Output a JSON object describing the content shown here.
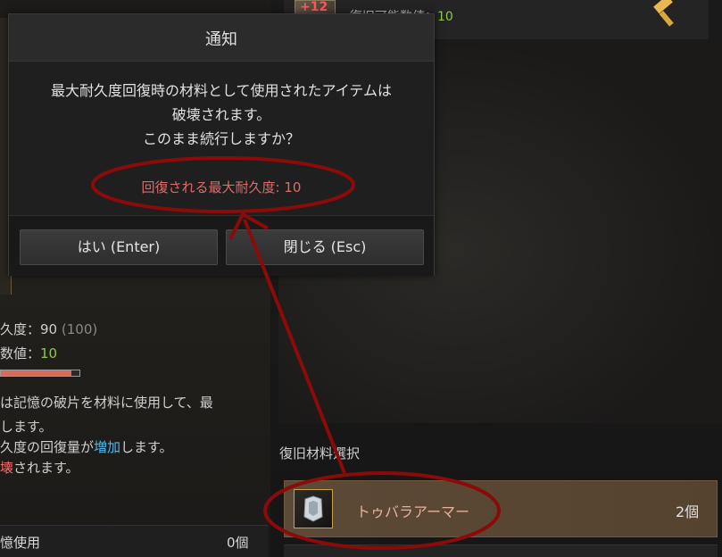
{
  "top_panel": {
    "icon_badge": "+12",
    "stat_label": "復旧可能数値：",
    "stat_value": "10"
  },
  "left_panel": {
    "durability_label": "久度：",
    "durability_value": "90",
    "durability_max": "(100)",
    "recover_label": "数値：",
    "recover_value": "10",
    "durability_ratio": 0.9,
    "desc_line1": "は記憶の破片を材料に使用して、最",
    "desc_line2": "します。",
    "desc_line3_a": "久度の回復量が",
    "desc_line3_b": "増加",
    "desc_line3_c": "します。",
    "desc_line4_a": "壊",
    "desc_line4_b": "されます。",
    "bottom_label": "憶使用",
    "bottom_count": "0個"
  },
  "dialog": {
    "title": "通知",
    "message_line1": "最大耐久度回復時の材料として使用されたアイテムは",
    "message_line2": "破壊されます。",
    "message_line3": "このまま続行しますか？",
    "recover_text": "回復される最大耐久度: 10",
    "yes_label": "はい (Enter)",
    "close_label": "閉じる (Esc)"
  },
  "materials": {
    "section_title": "復旧材料選択",
    "items": [
      {
        "name": "トゥバラアーマー",
        "count": "2個"
      }
    ]
  },
  "colors": {
    "annotation": "#8b0a0a",
    "warning_text": "#e06a6a",
    "stat_green": "#8fc74a"
  }
}
